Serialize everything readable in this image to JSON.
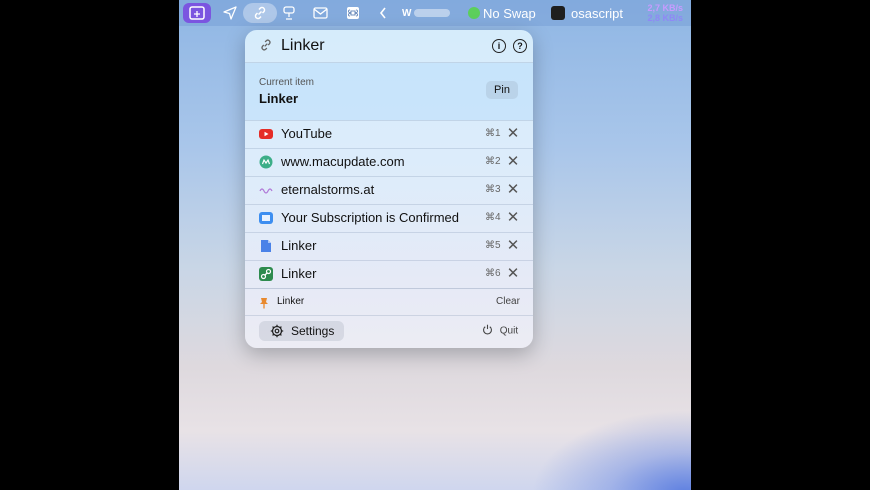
{
  "menubar": {
    "icons": [
      "inbox-icon",
      "paper-plane-icon",
      "link-icon",
      "lamp-icon",
      "mail-icon",
      "command-icon",
      "chevron-left-icon"
    ],
    "w_label": "W",
    "no_swap": "No Swap",
    "app": "osascript",
    "net_up": "2,7 KB/s",
    "net_down": "2,8 KB/s",
    "swap_color": "#5ccf5c",
    "accent": "#7b55e0"
  },
  "popup": {
    "title": "Linker",
    "info_icon": "info-icon",
    "help_icon": "help-icon",
    "current": {
      "label": "Current item",
      "value": "Linker",
      "pin_label": "Pin"
    },
    "items": [
      {
        "label": "YouTube",
        "key": "⌘1",
        "icon": "youtube-icon"
      },
      {
        "label": "www.macupdate.com",
        "key": "⌘2",
        "icon": "macupdate-icon"
      },
      {
        "label": "eternalstorms.at",
        "key": "⌘3",
        "icon": "eternalstorms-icon"
      },
      {
        "label": "Your Subscription is Confirmed",
        "key": "⌘4",
        "icon": "mail-app-icon"
      },
      {
        "label": "Linker",
        "key": "⌘5",
        "icon": "document-icon"
      },
      {
        "label": "Linker",
        "key": "⌘6",
        "icon": "linker-app-icon"
      }
    ],
    "pinned": {
      "label": "Linker",
      "clear": "Clear"
    },
    "settings_label": "Settings",
    "quit_label": "Quit"
  }
}
